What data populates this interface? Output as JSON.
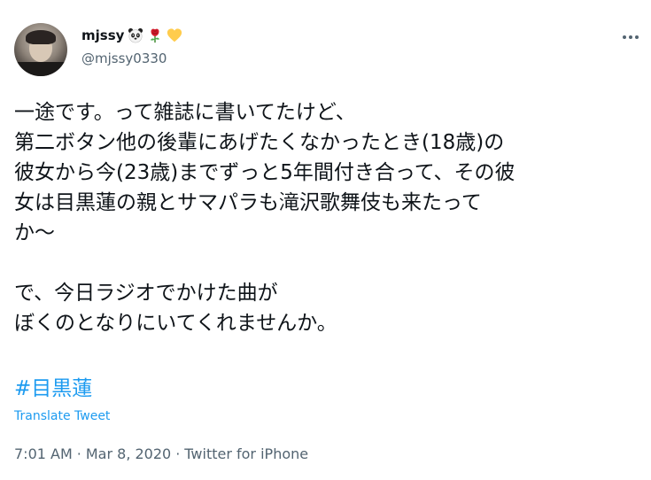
{
  "author": {
    "display_name": "mjssy",
    "emojis": [
      "panda-face-icon",
      "rose-icon",
      "yellow-heart-icon"
    ],
    "handle": "@mjssy0330"
  },
  "tweet": {
    "text": "一途です。って雑誌に書いてたけど、\n第二ボタン他の後輩にあげたくなかったとき(18歳)の\n彼女から今(23歳)までずっと5年間付き合って、その彼\n女は目黒蓮の親とサマパラも滝沢歌舞伎も来たって\nか〜\n\nで、今日ラジオでかけた曲が\nぼくのとなりにいてくれませんか。",
    "hashtag": "#目黒蓮",
    "translate_label": "Translate Tweet",
    "time": "7:01 AM",
    "date": "Mar 8, 2020",
    "separator": "·",
    "source": "Twitter for iPhone"
  },
  "colors": {
    "link": "#1d9bf0",
    "secondary_text": "#536471",
    "primary_text": "#0f1419"
  }
}
